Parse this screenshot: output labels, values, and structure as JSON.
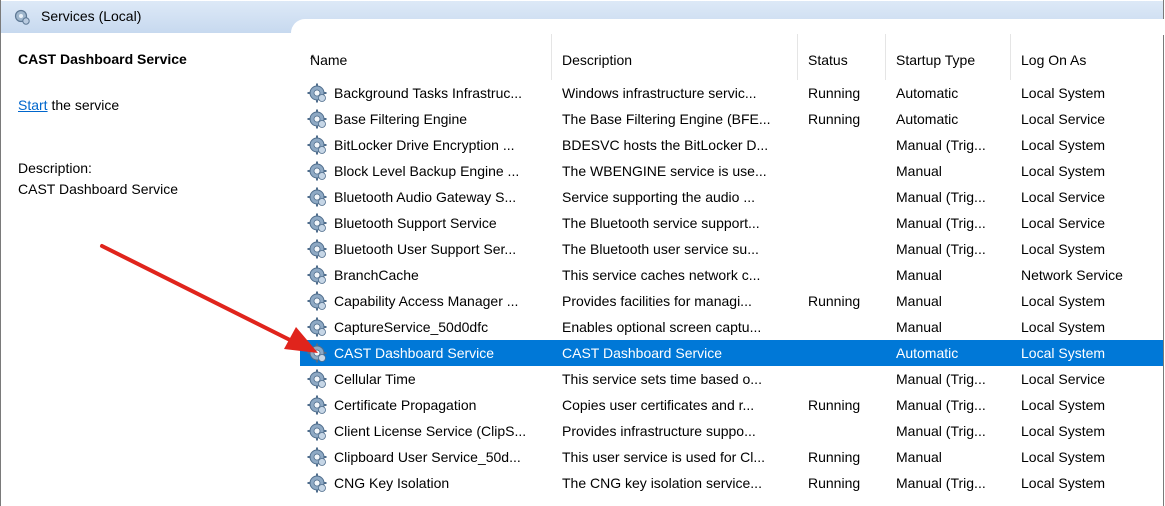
{
  "window": {
    "title": "Services (Local)"
  },
  "left_pane": {
    "service_name": "CAST Dashboard Service",
    "start_link": "Start",
    "start_suffix": " the service",
    "description_label": "Description:",
    "description": "CAST Dashboard Service"
  },
  "columns": {
    "name": "Name",
    "description": "Description",
    "status": "Status",
    "startup": "Startup Type",
    "logon": "Log On As"
  },
  "services": [
    {
      "name": "Background Tasks Infrastruc...",
      "description": "Windows infrastructure servic...",
      "status": "Running",
      "startup": "Automatic",
      "logon": "Local System"
    },
    {
      "name": "Base Filtering Engine",
      "description": "The Base Filtering Engine (BFE...",
      "status": "Running",
      "startup": "Automatic",
      "logon": "Local Service"
    },
    {
      "name": "BitLocker Drive Encryption ...",
      "description": "BDESVC hosts the BitLocker D...",
      "status": "",
      "startup": "Manual (Trig...",
      "logon": "Local System"
    },
    {
      "name": "Block Level Backup Engine ...",
      "description": "The WBENGINE service is use...",
      "status": "",
      "startup": "Manual",
      "logon": "Local System"
    },
    {
      "name": "Bluetooth Audio Gateway S...",
      "description": "Service supporting the audio ...",
      "status": "",
      "startup": "Manual (Trig...",
      "logon": "Local Service"
    },
    {
      "name": "Bluetooth Support Service",
      "description": "The Bluetooth service support...",
      "status": "",
      "startup": "Manual (Trig...",
      "logon": "Local Service"
    },
    {
      "name": "Bluetooth User Support Ser...",
      "description": "The Bluetooth user service su...",
      "status": "",
      "startup": "Manual (Trig...",
      "logon": "Local System"
    },
    {
      "name": "BranchCache",
      "description": "This service caches network c...",
      "status": "",
      "startup": "Manual",
      "logon": "Network Service"
    },
    {
      "name": "Capability Access Manager ...",
      "description": "Provides facilities for managi...",
      "status": "Running",
      "startup": "Manual",
      "logon": "Local System"
    },
    {
      "name": "CaptureService_50d0dfc",
      "description": "Enables optional screen captu...",
      "status": "",
      "startup": "Manual",
      "logon": "Local System"
    },
    {
      "name": "CAST Dashboard Service",
      "description": "CAST Dashboard Service",
      "status": "",
      "startup": "Automatic",
      "logon": "Local System"
    },
    {
      "name": "Cellular Time",
      "description": "This service sets time based o...",
      "status": "",
      "startup": "Manual (Trig...",
      "logon": "Local Service"
    },
    {
      "name": "Certificate Propagation",
      "description": "Copies user certificates and r...",
      "status": "Running",
      "startup": "Manual (Trig...",
      "logon": "Local System"
    },
    {
      "name": "Client License Service (ClipS...",
      "description": "Provides infrastructure suppo...",
      "status": "",
      "startup": "Manual (Trig...",
      "logon": "Local System"
    },
    {
      "name": "Clipboard User Service_50d...",
      "description": "This user service is used for Cl...",
      "status": "Running",
      "startup": "Manual",
      "logon": "Local System"
    },
    {
      "name": "CNG Key Isolation",
      "description": "The CNG key isolation service...",
      "status": "Running",
      "startup": "Manual (Trig...",
      "logon": "Local System"
    }
  ],
  "selected_index": 10,
  "colors": {
    "selection": "#0078d7",
    "arrow": "#e0241c",
    "link": "#0066cc"
  },
  "icons": {
    "row": "gear-icon",
    "title": "services-icon"
  }
}
